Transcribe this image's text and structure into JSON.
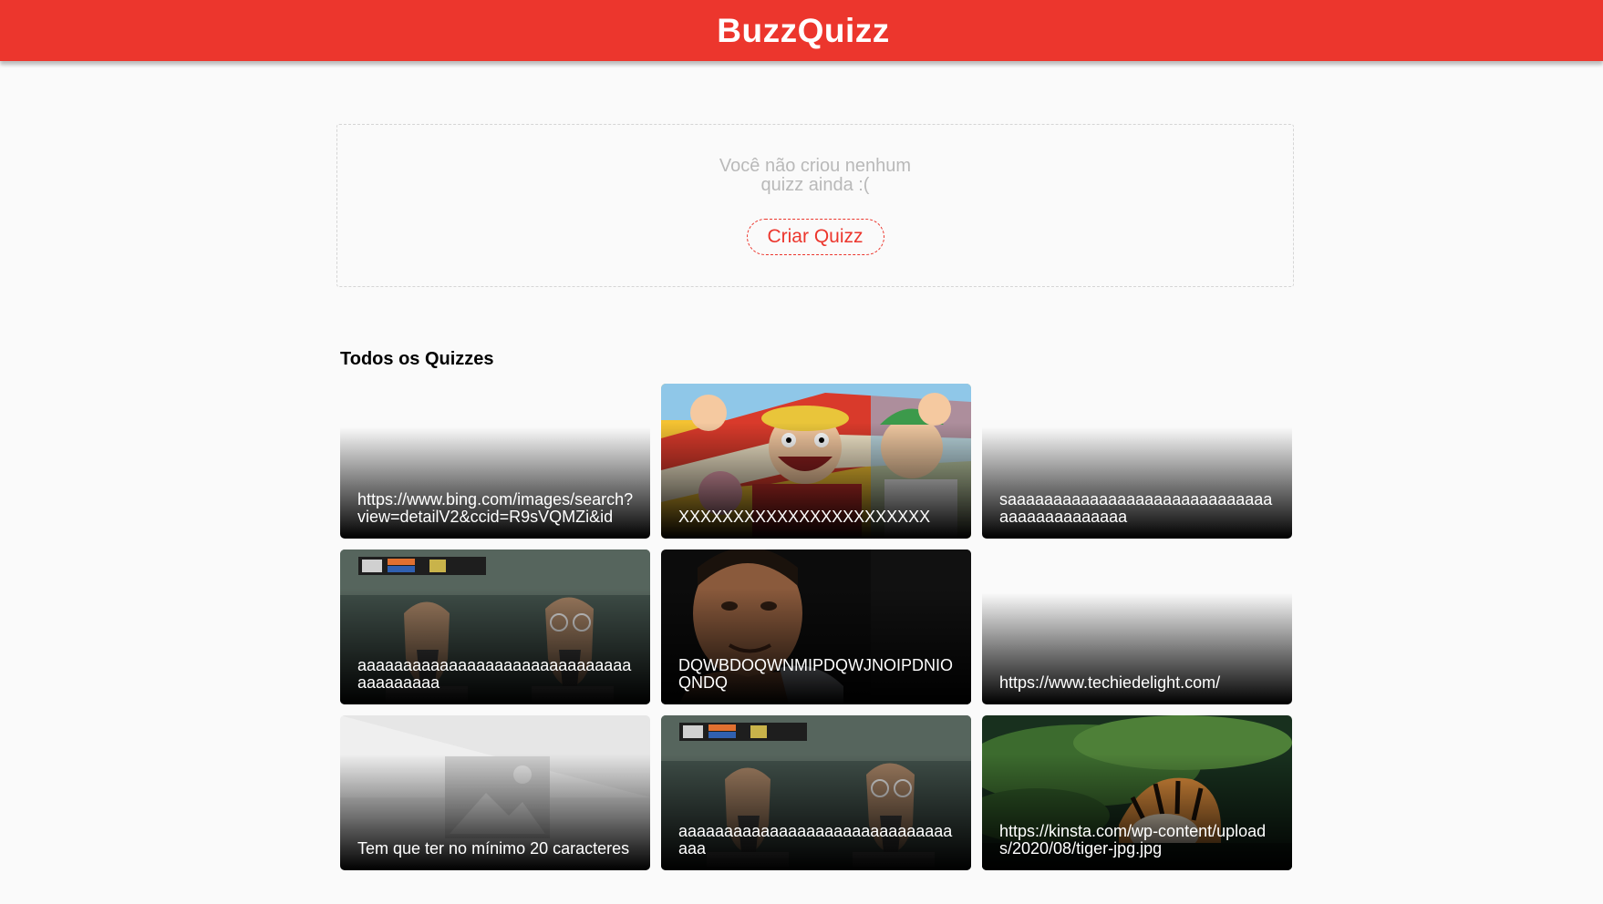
{
  "header": {
    "logo": "BuzzQuizz"
  },
  "user_quizzes": {
    "empty_message": "Você não criou nenhum quizz ainda :(",
    "create_button": "Criar Quizz"
  },
  "all_quizzes": {
    "title": "Todos os Quizzes",
    "items": [
      {
        "title": "https://www.bing.com/images/search?view=detailV2&ccid=R9sVQMZi&id",
        "image": "none"
      },
      {
        "title": "XXXXXXXXXXXXXXXXXXXXXXX",
        "image": "anime-characters-cheering"
      },
      {
        "title": "saaaaaaaaaaaaaaaaaaaaaaaaaaaaaaaaaaaaaaaaaaa",
        "image": "none"
      },
      {
        "title": "aaaaaaaaaaaaaaaaaaaaaaaaaaaaaaaaaaaaaaa",
        "image": "horse-masks-baseball-broadcast"
      },
      {
        "title": "DQWBDOQWNMIPDQWJNOIPDNIOQNDQ",
        "image": "man-portrait"
      },
      {
        "title": "https://www.techiedelight.com/",
        "image": "none"
      },
      {
        "title": "Tem que ter no mínimo 20 caracteres",
        "image": "image-placeholder"
      },
      {
        "title": "aaaaaaaaaaaaaaaaaaaaaaaaaaaaaaaaa",
        "image": "horse-masks-baseball-broadcast"
      },
      {
        "title": "https://kinsta.com/wp-content/uploads/2020/08/tiger-jpg.jpg",
        "image": "tiger-in-water"
      }
    ]
  },
  "colors": {
    "brand": "#EC362D",
    "background": "#FAFAFA",
    "muted_text": "#B9B9B9"
  }
}
